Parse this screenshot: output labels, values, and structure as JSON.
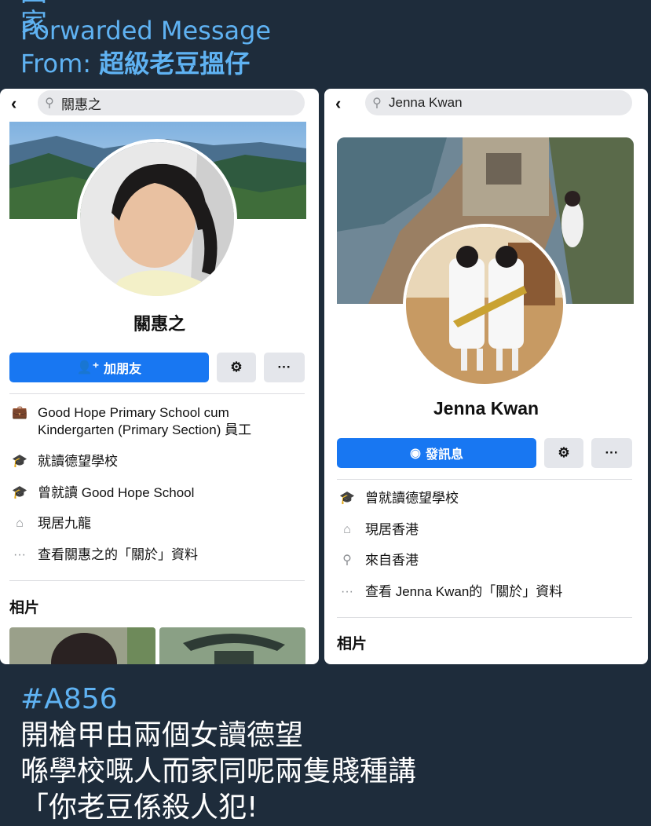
{
  "message": {
    "cutoff_title": "回家",
    "forwarded_label": "Forwarded Message",
    "from_label": "From: ",
    "from_name": "超級老豆搵仔",
    "hashtag": "#A856",
    "caption_lines": [
      "開槍甲由兩個女讀德望",
      "喺學校嘅人而家同呢兩隻賤種講",
      "「你老豆係殺人犯!"
    ]
  },
  "left_profile": {
    "search_query": "關惠之",
    "name": "關惠之",
    "add_friend_label": "加朋友",
    "more_label": "···",
    "info": [
      {
        "icon": "briefcase-icon",
        "text": "Good Hope Primary School cum Kindergarten (Primary Section) 員工"
      },
      {
        "icon": "graduation-cap-icon",
        "text": "就讀德望學校"
      },
      {
        "icon": "graduation-cap-icon",
        "text": "曾就讀 Good Hope School"
      },
      {
        "icon": "home-icon",
        "text": "現居九龍"
      },
      {
        "icon": "more-dots-icon",
        "text": "查看關惠之的「關於」資料"
      }
    ],
    "photos_title": "相片"
  },
  "right_profile": {
    "search_query": "Jenna Kwan",
    "name": "Jenna Kwan",
    "message_label": "發訊息",
    "more_label": "···",
    "info": [
      {
        "icon": "graduation-cap-icon",
        "text": "曾就讀德望學校"
      },
      {
        "icon": "home-icon",
        "text": "現居香港"
      },
      {
        "icon": "location-pin-icon",
        "text": "來自香港"
      },
      {
        "icon": "more-dots-icon",
        "text": "查看 Jenna Kwan的「關於」資料"
      }
    ],
    "photos_title": "相片"
  },
  "colors": {
    "background": "#1e2c3b",
    "accent_text": "#5fb2f2",
    "facebook_blue": "#1877f2"
  }
}
